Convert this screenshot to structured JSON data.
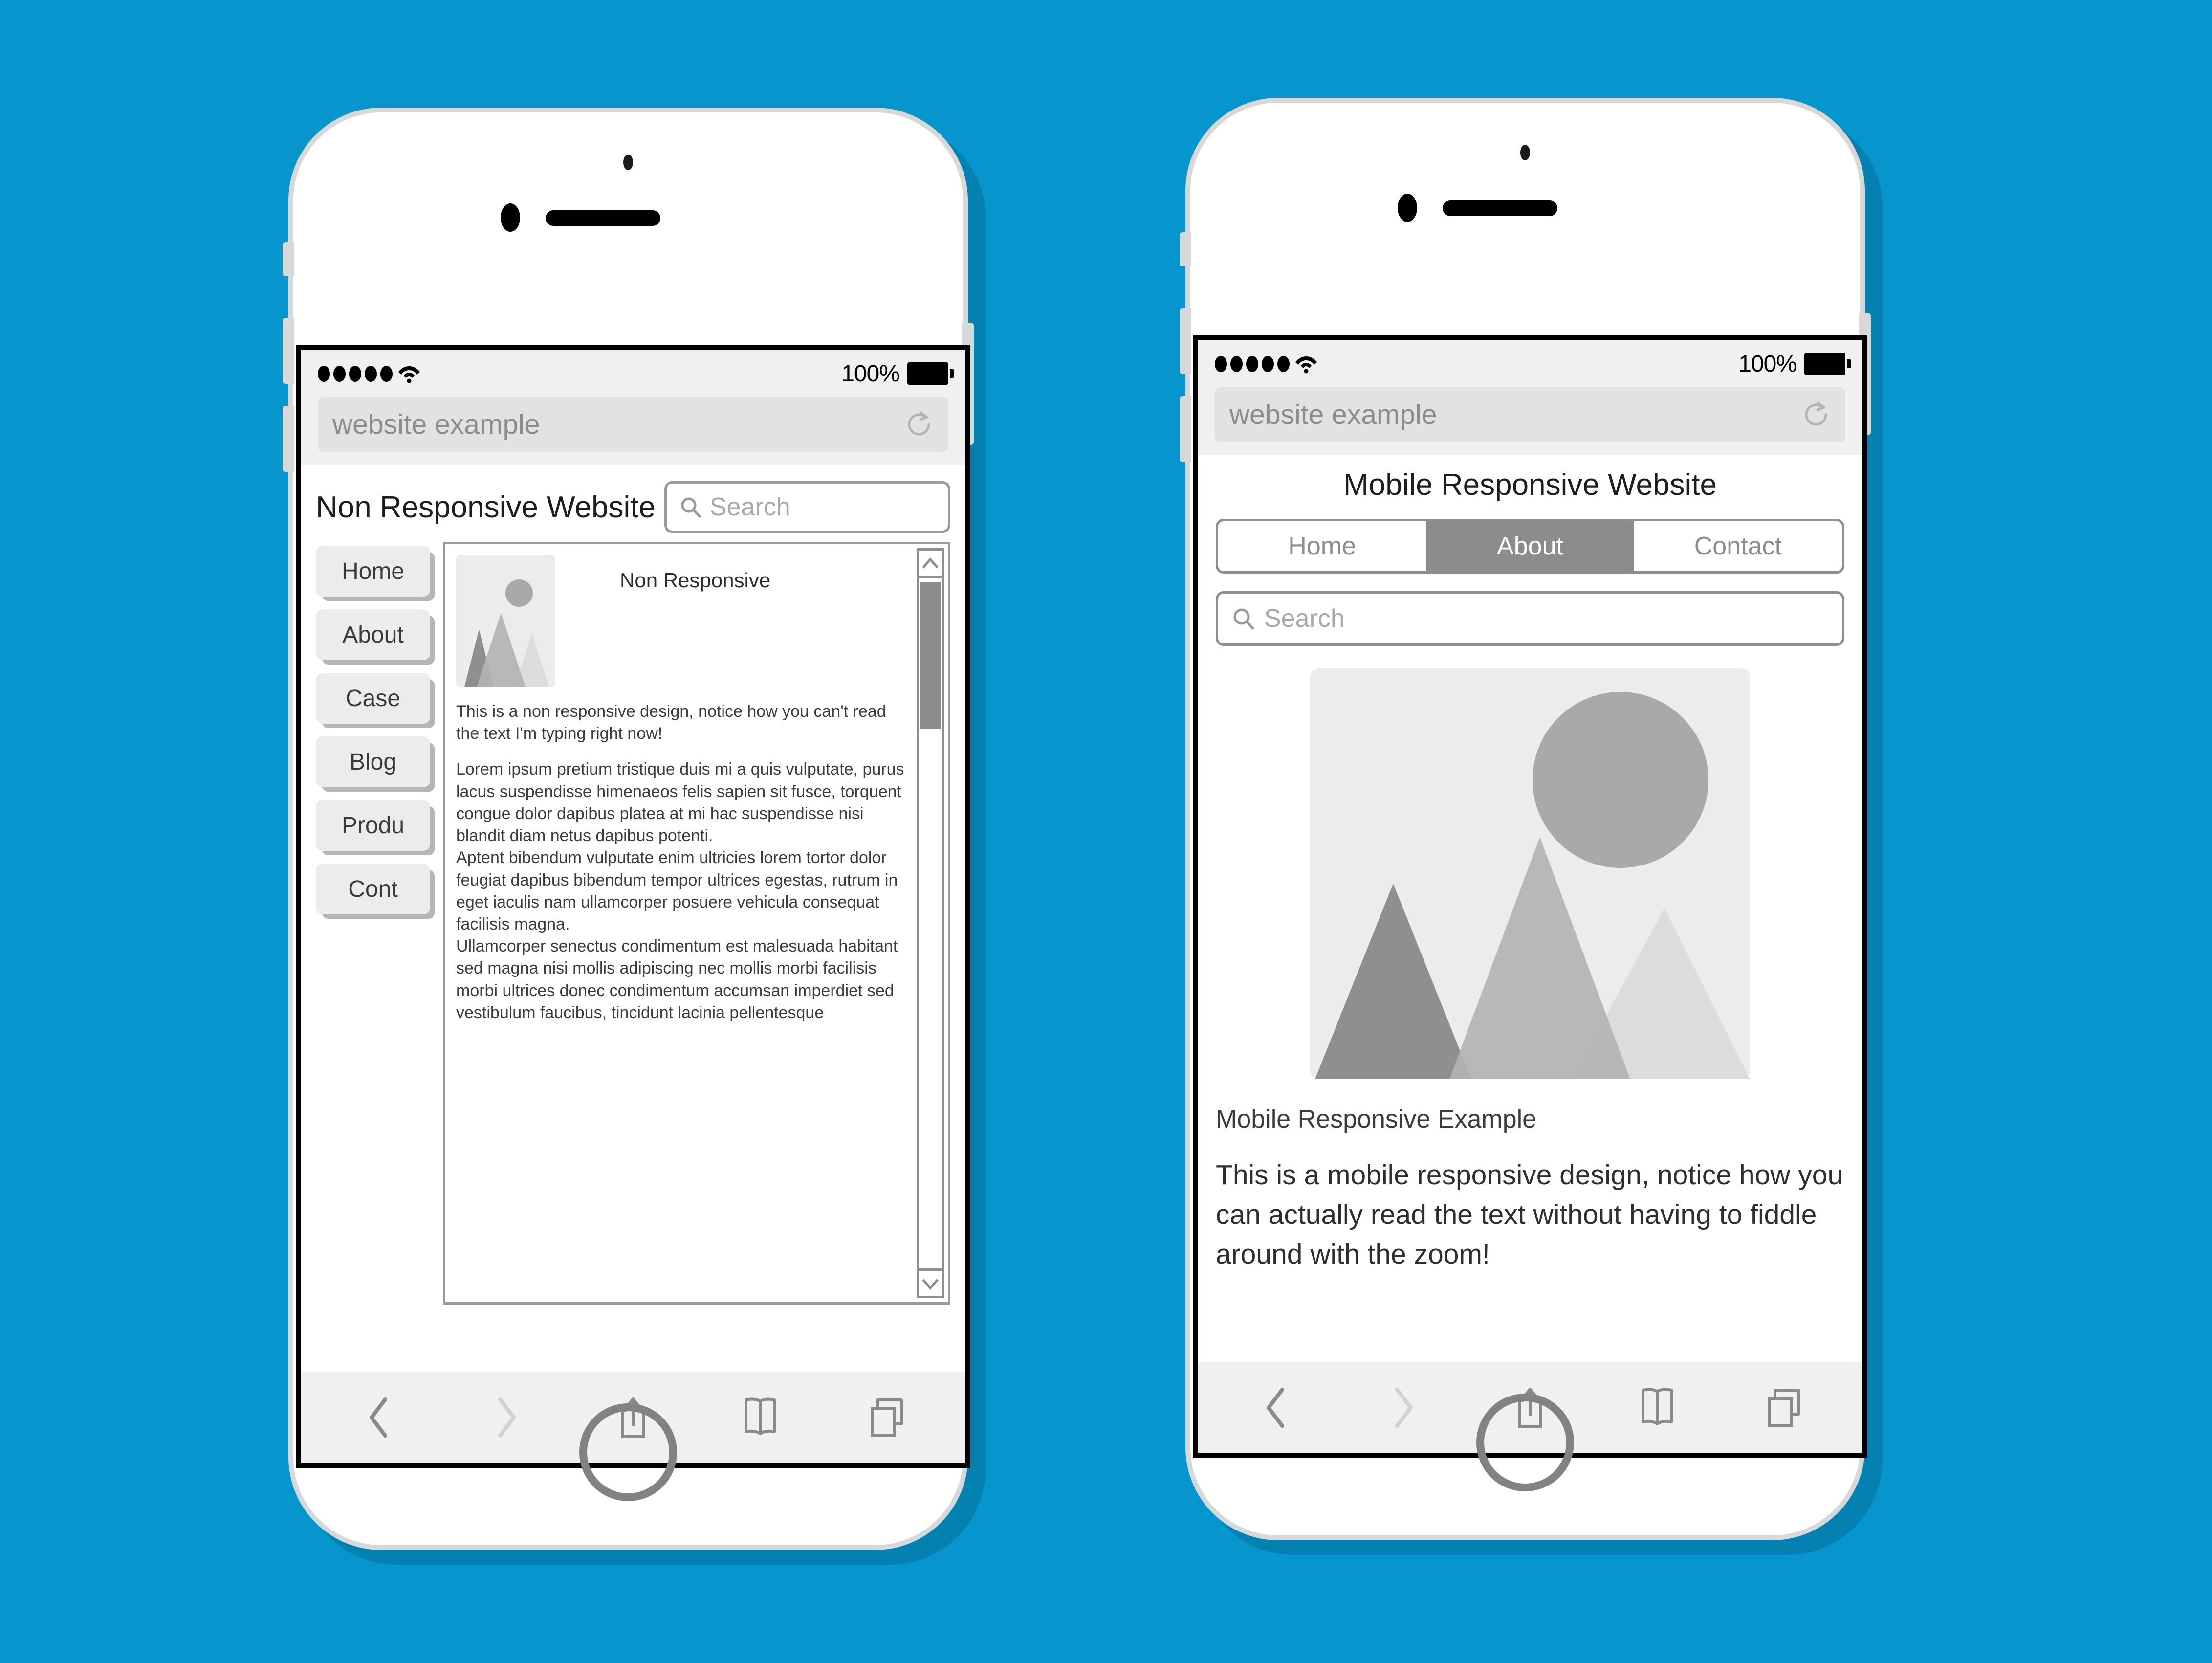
{
  "background_color": "#0695cc",
  "phones": [
    {
      "id": "non-responsive",
      "status_bar": {
        "battery_percent": "100%",
        "signal_dots": 5,
        "wifi": "wifi-icon"
      },
      "browser": {
        "url_value": "website example",
        "reload_icon": "reload-icon",
        "toolbar": [
          {
            "icon": "back-icon",
            "label": "Back",
            "state": "enabled"
          },
          {
            "icon": "forward-icon",
            "label": "Forward",
            "state": "disabled"
          },
          {
            "icon": "share-icon",
            "label": "Share"
          },
          {
            "icon": "bookmarks-icon",
            "label": "Bookmarks"
          },
          {
            "icon": "tabs-icon",
            "label": "Tabs"
          }
        ]
      },
      "site": {
        "title": "Non Responsive Website",
        "search_placeholder": "Search",
        "search_icon": "search-icon",
        "nav_items": [
          "Home",
          "About",
          "Case",
          "Blog",
          "Produ",
          "Cont"
        ],
        "image_caption": "Non Responsive",
        "image_alt": "mountain-placeholder",
        "paragraphs": [
          "This is a non responsive design, notice how you can't read the text I'm typing right now!",
          "Lorem ipsum pretium tristique duis mi a quis vulputate, purus lacus suspendisse himenaeos felis sapien sit fusce, torquent congue dolor dapibus platea at mi hac suspendisse nisi blandit diam netus dapibus potenti.",
          "Aptent bibendum vulputate enim ultricies lorem tortor dolor feugiat dapibus bibendum tempor ultrices egestas, rutrum in eget iaculis nam ullamcorper posuere vehicula consequat facilisis magna.",
          "Ullamcorper senectus condimentum est malesuada habitant sed magna nisi mollis adipiscing nec mollis morbi facilisis morbi ultrices donec condimentum accumsan imperdiet sed vestibulum faucibus, tincidunt lacinia pellentesque"
        ],
        "scrollbar": {
          "up_icon": "chevron-up-icon",
          "down_icon": "chevron-down-icon"
        }
      }
    },
    {
      "id": "mobile-responsive",
      "status_bar": {
        "battery_percent": "100%",
        "signal_dots": 5,
        "wifi": "wifi-icon"
      },
      "browser": {
        "url_value": "website example",
        "reload_icon": "reload-icon",
        "toolbar": [
          {
            "icon": "back-icon",
            "label": "Back",
            "state": "enabled"
          },
          {
            "icon": "forward-icon",
            "label": "Forward",
            "state": "disabled"
          },
          {
            "icon": "share-icon",
            "label": "Share"
          },
          {
            "icon": "bookmarks-icon",
            "label": "Bookmarks"
          },
          {
            "icon": "tabs-icon",
            "label": "Tabs"
          }
        ]
      },
      "site": {
        "title": "Mobile Responsive Website",
        "tabs": [
          {
            "label": "Home",
            "active": false
          },
          {
            "label": "About",
            "active": true
          },
          {
            "label": "Contact",
            "active": false
          }
        ],
        "search_placeholder": "Search",
        "search_icon": "search-icon",
        "image_alt": "mountain-placeholder",
        "subtitle": "Mobile Responsive Example",
        "body": "This is a mobile responsive design, notice how you can actually read the text without having to fiddle around with the zoom!"
      }
    }
  ],
  "colors": {
    "background": "#0695cc",
    "frame": "#d6d8d9",
    "screen_border": "#000000",
    "chrome": "#f0f0f0",
    "url_field": "#e2e2e2",
    "active_tab": "#8c8c8c",
    "button_face": "#ececec",
    "button_shadow": "#b6b6b6",
    "img_bg": "#ececec",
    "mountain_dark": "#8f8f8f",
    "mountain_mid": "#b3b3b3",
    "mountain_light": "#dcdcdc",
    "sun": "#a9a9a9"
  }
}
